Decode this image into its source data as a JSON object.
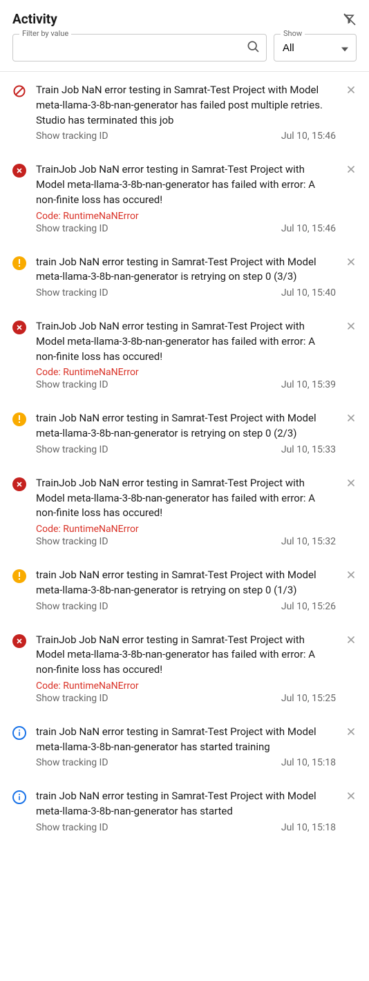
{
  "header": {
    "title": "Activity"
  },
  "filter": {
    "legend": "Filter by value",
    "placeholder": ""
  },
  "show": {
    "legend": "Show",
    "selected": "All",
    "options": [
      "All"
    ]
  },
  "tracking_label": "Show tracking ID",
  "items": [
    {
      "icon": "forbid",
      "message": "Train Job NaN error testing in Samrat-Test Project with Model meta-llama-3-8b-nan-generator has failed post multiple retries. Studio has terminated this job",
      "code": "",
      "time": "Jul 10, 15:46"
    },
    {
      "icon": "error",
      "message": "TrainJob Job NaN error testing in Samrat-Test Project with Model meta-llama-3-8b-nan-generator has failed with error: A non-finite loss has occured!",
      "code": "Code: RuntimeNaNError",
      "time": "Jul 10, 15:46"
    },
    {
      "icon": "warn",
      "message": "train Job NaN error testing in Samrat-Test Project with Model meta-llama-3-8b-nan-generator is retrying on step 0 (3/3)",
      "code": "",
      "time": "Jul 10, 15:40"
    },
    {
      "icon": "error",
      "message": "TrainJob Job NaN error testing in Samrat-Test Project with Model meta-llama-3-8b-nan-generator has failed with error: A non-finite loss has occured!",
      "code": "Code: RuntimeNaNError",
      "time": "Jul 10, 15:39"
    },
    {
      "icon": "warn",
      "message": "train Job NaN error testing in Samrat-Test Project with Model meta-llama-3-8b-nan-generator is retrying on step 0 (2/3)",
      "code": "",
      "time": "Jul 10, 15:33"
    },
    {
      "icon": "error",
      "message": "TrainJob Job NaN error testing in Samrat-Test Project with Model meta-llama-3-8b-nan-generator has failed with error: A non-finite loss has occured!",
      "code": "Code: RuntimeNaNError",
      "time": "Jul 10, 15:32"
    },
    {
      "icon": "warn",
      "message": "train Job NaN error testing in Samrat-Test Project with Model meta-llama-3-8b-nan-generator is retrying on step 0 (1/3)",
      "code": "",
      "time": "Jul 10, 15:26"
    },
    {
      "icon": "error",
      "message": "TrainJob Job NaN error testing in Samrat-Test Project with Model meta-llama-3-8b-nan-generator has failed with error: A non-finite loss has occured!",
      "code": "Code: RuntimeNaNError",
      "time": "Jul 10, 15:25"
    },
    {
      "icon": "info",
      "message": "train Job NaN error testing in Samrat-Test Project with Model meta-llama-3-8b-nan-generator has started training",
      "code": "",
      "time": "Jul 10, 15:18"
    },
    {
      "icon": "info",
      "message": "train Job NaN error testing in Samrat-Test Project with Model meta-llama-3-8b-nan-generator has started",
      "code": "",
      "time": "Jul 10, 15:18"
    }
  ]
}
